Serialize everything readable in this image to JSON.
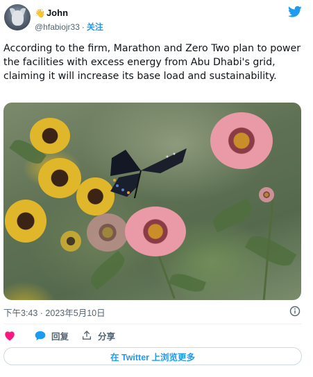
{
  "author": {
    "emoji": "👋",
    "display_name": "John",
    "handle": "@hfabiojr33",
    "separator": "·",
    "follow_label": "关注"
  },
  "tweet": {
    "text": "According to the firm, Marathon and Zero Two plan to power the facilities with excess energy from Abu Dhabi's grid, claiming it will increase its base load and sustainability."
  },
  "meta": {
    "timestamp": "下午3:43 · 2023年5月10日"
  },
  "actions": {
    "reply_label": "回复",
    "share_label": "分享"
  },
  "more_button": {
    "label": "在 Twitter 上浏览更多"
  },
  "colors": {
    "accent": "#1d9bf0",
    "like": "#f91880",
    "text": "#0f1419",
    "muted": "#536471",
    "border": "#cfd9de"
  },
  "icons": {
    "brand": "twitter-bird-icon",
    "info": "info-icon",
    "like": "heart-icon",
    "reply": "speech-bubble-icon",
    "share": "share-upload-icon"
  }
}
